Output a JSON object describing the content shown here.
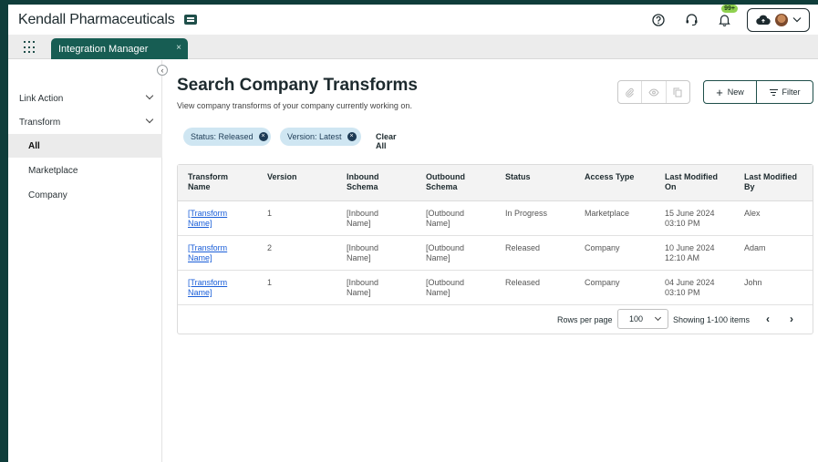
{
  "app": {
    "brand": "Kendall Pharmaceuticals",
    "notification_count": "99+"
  },
  "tabs": [
    {
      "label": "Integration Manager",
      "close": "×"
    }
  ],
  "sidebar": {
    "collapse_glyph": "‹",
    "items": [
      {
        "label": "Link Action",
        "expandable": true
      },
      {
        "label": "Transform",
        "expandable": true
      }
    ],
    "subitems": [
      {
        "label": "All",
        "selected": true
      },
      {
        "label": "Marketplace",
        "selected": false
      },
      {
        "label": "Company",
        "selected": false
      }
    ]
  },
  "main": {
    "title": "Search Company Transforms",
    "subtitle": "View company transforms of your company currently working on.",
    "new_label": "New",
    "new_glyph": "+",
    "filter_label": "Filter",
    "filters": [
      {
        "label": "Status: Released",
        "remove": "×"
      },
      {
        "label": "Version: Latest",
        "remove": "×"
      }
    ],
    "clear_all": "Clear All"
  },
  "table": {
    "columns": [
      "Transform Name",
      "Version",
      "Inbound Schema",
      "Outbound Schema",
      "Status",
      "Access Type",
      "Last Modified On",
      "Last Modified By"
    ],
    "rows": [
      [
        "[Transform Name]",
        "1",
        "[Inbound Name]",
        "[Outbound Name]",
        "In Progress",
        "Marketplace",
        "15 June 2024 03:10 PM",
        "Alex"
      ],
      [
        "[Transform Name]",
        "2",
        "[Inbound Name]",
        "[Outbound Name]",
        "Released",
        "Company",
        "10 June 2024 12:10 AM",
        "Adam"
      ],
      [
        "[Transform Name]",
        "1",
        "[Inbound Name]",
        "[Outbound Name]",
        "Released",
        "Company",
        "04 June 2024 03:10 PM",
        "John"
      ]
    ]
  },
  "pager": {
    "rows_per_page_label": "Rows per page",
    "rows_per_page_value": "100",
    "showing": "Showing 1-100 items",
    "prev": "‹",
    "next": "›"
  },
  "colors": {
    "accent": "#175d53",
    "frame": "#0f3d3a",
    "chip": "#cfe6f2",
    "link": "#1a5ed8",
    "badge": "#8fd14f"
  },
  "icons": [
    "apps-grid-icon",
    "help-icon",
    "headset-icon",
    "bell-icon",
    "cloud-icon",
    "chevron-down-icon",
    "attach-icon",
    "eye-icon",
    "copy-icon",
    "plus-icon",
    "filter-icon",
    "chevron-left-icon",
    "chevron-right-icon"
  ]
}
